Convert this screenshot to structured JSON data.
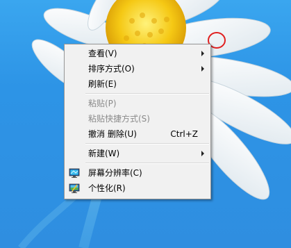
{
  "context_menu": {
    "items": [
      {
        "label": "查看(V)",
        "submenu": true,
        "enabled": true
      },
      {
        "label": "排序方式(O)",
        "submenu": true,
        "enabled": true
      },
      {
        "label": "刷新(E)",
        "submenu": false,
        "enabled": true
      },
      {
        "label": "粘贴(P)",
        "submenu": false,
        "enabled": false
      },
      {
        "label": "粘贴快捷方式(S)",
        "submenu": false,
        "enabled": false
      },
      {
        "label": "撤消 删除(U)",
        "shortcut": "Ctrl+Z",
        "submenu": false,
        "enabled": true
      },
      {
        "label": "新建(W)",
        "submenu": true,
        "enabled": true
      },
      {
        "label": "屏幕分辨率(C)",
        "icon": "monitor-icon",
        "submenu": false,
        "enabled": true
      },
      {
        "label": "个性化(R)",
        "icon": "personalize-icon",
        "submenu": false,
        "enabled": true
      }
    ]
  },
  "colors": {
    "desktop_blue": "#2f95e6",
    "menu_background": "#f1f1f1",
    "annotation_red": "#e02020"
  }
}
